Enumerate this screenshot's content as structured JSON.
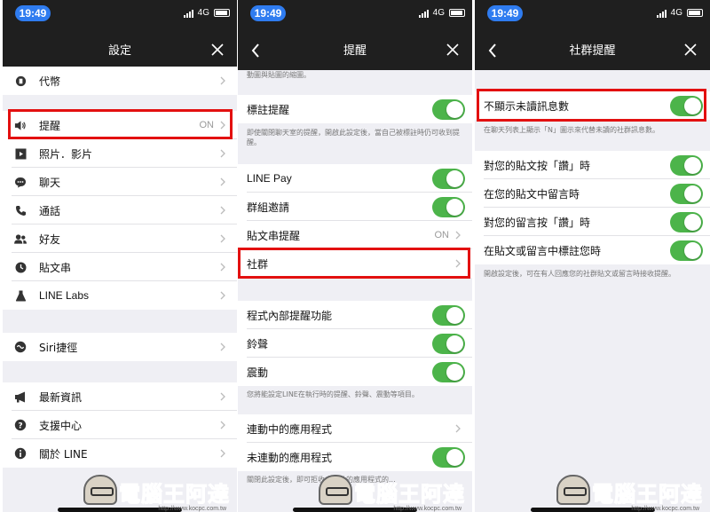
{
  "status": {
    "time": "19:49",
    "network": "4G"
  },
  "settings": {
    "title": "設定",
    "items": [
      {
        "icon": "coin-icon",
        "label": "代幣"
      },
      {
        "icon": "speaker-icon",
        "label": "提醒",
        "value": "ON"
      },
      {
        "icon": "media-icon",
        "label": "照片．影片"
      },
      {
        "icon": "chat-icon",
        "label": "聊天"
      },
      {
        "icon": "phone-icon",
        "label": "通話"
      },
      {
        "icon": "friends-icon",
        "label": "好友"
      },
      {
        "icon": "timeline-icon",
        "label": "貼文串"
      },
      {
        "icon": "flask-icon",
        "label": "LINE Labs"
      },
      {
        "icon": "siri-icon",
        "label": "Siri捷徑"
      },
      {
        "icon": "megaphone-icon",
        "label": "最新資訊"
      },
      {
        "icon": "help-icon",
        "label": "支援中心"
      },
      {
        "icon": "info-icon",
        "label": "關於 LINE"
      }
    ]
  },
  "notifications": {
    "title": "提醒",
    "top_note": "動圖與貼圖的縮圖。",
    "mention": {
      "label": "標註提醒",
      "note": "即使關閉聊天室的提醒，開啟此設定後，當自己被標註時仍可收到提醒。"
    },
    "group_items": [
      {
        "label": "LINE Pay",
        "type": "toggle"
      },
      {
        "label": "群組邀請",
        "type": "toggle"
      },
      {
        "label": "貼文串提醒",
        "type": "value",
        "value": "ON"
      },
      {
        "label": "社群",
        "type": "chevron"
      }
    ],
    "inapp_items": [
      {
        "label": "程式內部提醒功能"
      },
      {
        "label": "鈴聲"
      },
      {
        "label": "震動"
      }
    ],
    "inapp_note": "您將能設定LINE在執行時的提醒、鈴聲、震動等項目。",
    "linked_apps": "連動中的應用程式",
    "unlinked_apps": "未連動的應用程式",
    "bottom_note": "關閉此設定後，即可拒收未連動的應用程式的..."
  },
  "community": {
    "title": "社群提醒",
    "hide_unread": {
      "label": "不顯示未讀訊息數",
      "note": "在聊天列表上顯示「N」圖示來代替未讀的社群訊息數。"
    },
    "items": [
      {
        "label": "對您的貼文按「讚」時"
      },
      {
        "label": "在您的貼文中留言時"
      },
      {
        "label": "對您的留言按「讚」時"
      },
      {
        "label": "在貼文或留言中標註您時"
      }
    ],
    "note": "開啟設定後，可在有人回應您的社群貼文或留言時接收提醒。"
  },
  "watermark": {
    "text": "電腦王阿達",
    "url": "http://www.kocpc.com.tw"
  },
  "colors": {
    "toggle_on": "#4cb44a",
    "highlight": "#e31010",
    "bar": "#1f1f1f",
    "time_pill": "#2f7cf0"
  }
}
